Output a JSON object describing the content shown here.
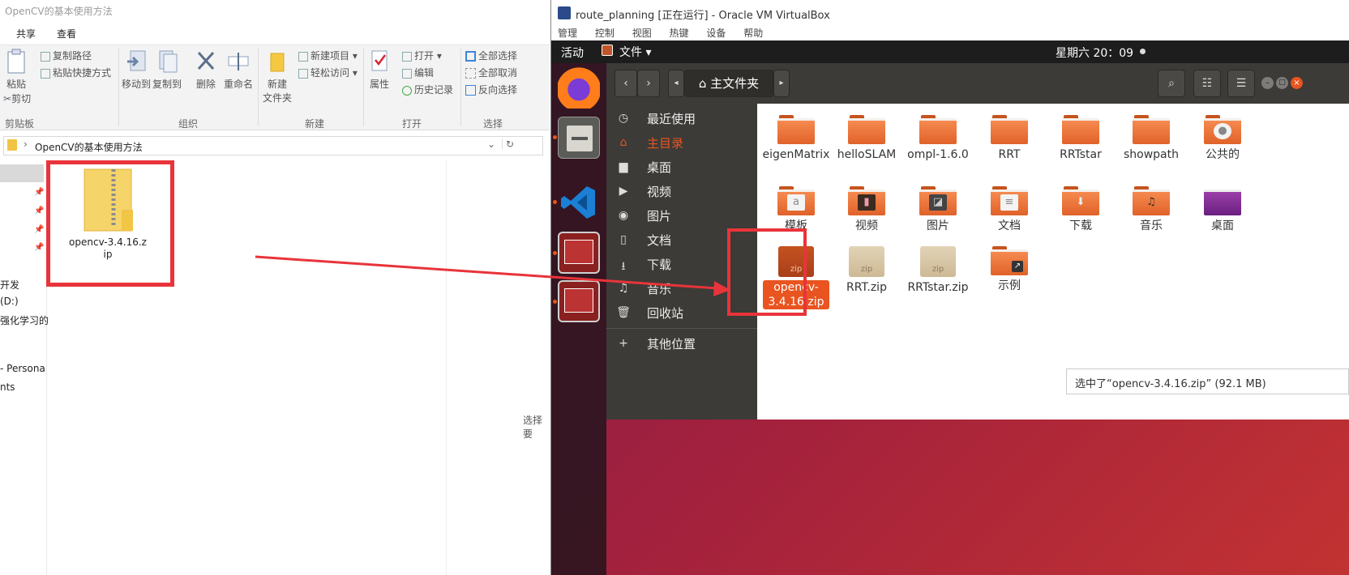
{
  "explorer": {
    "title": "OpenCV的基本使用方法",
    "tabs": [
      "共享",
      "查看"
    ],
    "ribbon": {
      "clipboard": {
        "paste": "粘贴",
        "copy_path": "复制路径",
        "paste_shortcut": "粘贴快捷方式",
        "cut": "剪切",
        "group": "剪贴板"
      },
      "organize": {
        "move_to": "移动到",
        "copy_to": "复制到",
        "delete": "删除",
        "rename": "重命名",
        "group": "组织"
      },
      "new": {
        "new_folder_line1": "新建",
        "new_folder_line2": "文件夹",
        "new_item": "新建项目",
        "easy_access": "轻松访问",
        "group": "新建"
      },
      "open": {
        "properties": "属性",
        "open": "打开",
        "edit": "编辑",
        "history": "历史记录",
        "group": "打开"
      },
      "select": {
        "select_all": "全部选择",
        "select_none": "全部取消",
        "invert": "反向选择",
        "group": "选择"
      }
    },
    "address": {
      "path": "OpenCV的基本使用方法"
    },
    "nav": {
      "items": [
        "开发",
        "(D:)",
        "强化学习的",
        "- Persona",
        "nts"
      ]
    },
    "file": {
      "name_line1": "opencv-3.4.16.z",
      "name_line2": "ip"
    },
    "status": "选择要"
  },
  "vbox": {
    "title": "route_planning [正在运行] - Oracle VM VirtualBox",
    "menu": [
      "管理",
      "控制",
      "视图",
      "热键",
      "设备",
      "帮助"
    ]
  },
  "ubuntu": {
    "activities": "活动",
    "app_menu": "文件",
    "clock": "星期六 20：09",
    "nautilus": {
      "location": "主文件夹",
      "sidebar": [
        {
          "icon": "clock-icon",
          "label": "最近使用"
        },
        {
          "icon": "home-icon",
          "label": "主目录"
        },
        {
          "icon": "desktop-folder-icon",
          "label": "桌面"
        },
        {
          "icon": "video-icon",
          "label": "视频"
        },
        {
          "icon": "camera-icon",
          "label": "图片"
        },
        {
          "icon": "document-icon",
          "label": "文档"
        },
        {
          "icon": "download-icon",
          "label": "下载"
        },
        {
          "icon": "music-icon",
          "label": "音乐"
        },
        {
          "icon": "trash-icon",
          "label": "回收站"
        },
        {
          "icon": "plus-icon",
          "label": "其他位置"
        }
      ],
      "row1": [
        "eigenMatrix",
        "helloSLAM",
        "ompl-1.6.0",
        "RRT",
        "RRTstar",
        "showpath",
        "公共的"
      ],
      "row2": [
        "模板",
        "视频",
        "图片",
        "文档",
        "下载",
        "音乐",
        "桌面"
      ],
      "row3": [
        "opencv-3.4.16.zip",
        "RRT.zip",
        "RRTstar.zip",
        "示例"
      ],
      "selected_line1": "opencv-",
      "selected_line2": "3.4.16.zip",
      "zip_label": "zip",
      "status": "选中了“opencv-3.4.16.zip” (92.1 MB)"
    }
  },
  "colors": {
    "accent": "#e95420",
    "highlight_box": "#e8343a",
    "arrow": "#e8343a"
  }
}
